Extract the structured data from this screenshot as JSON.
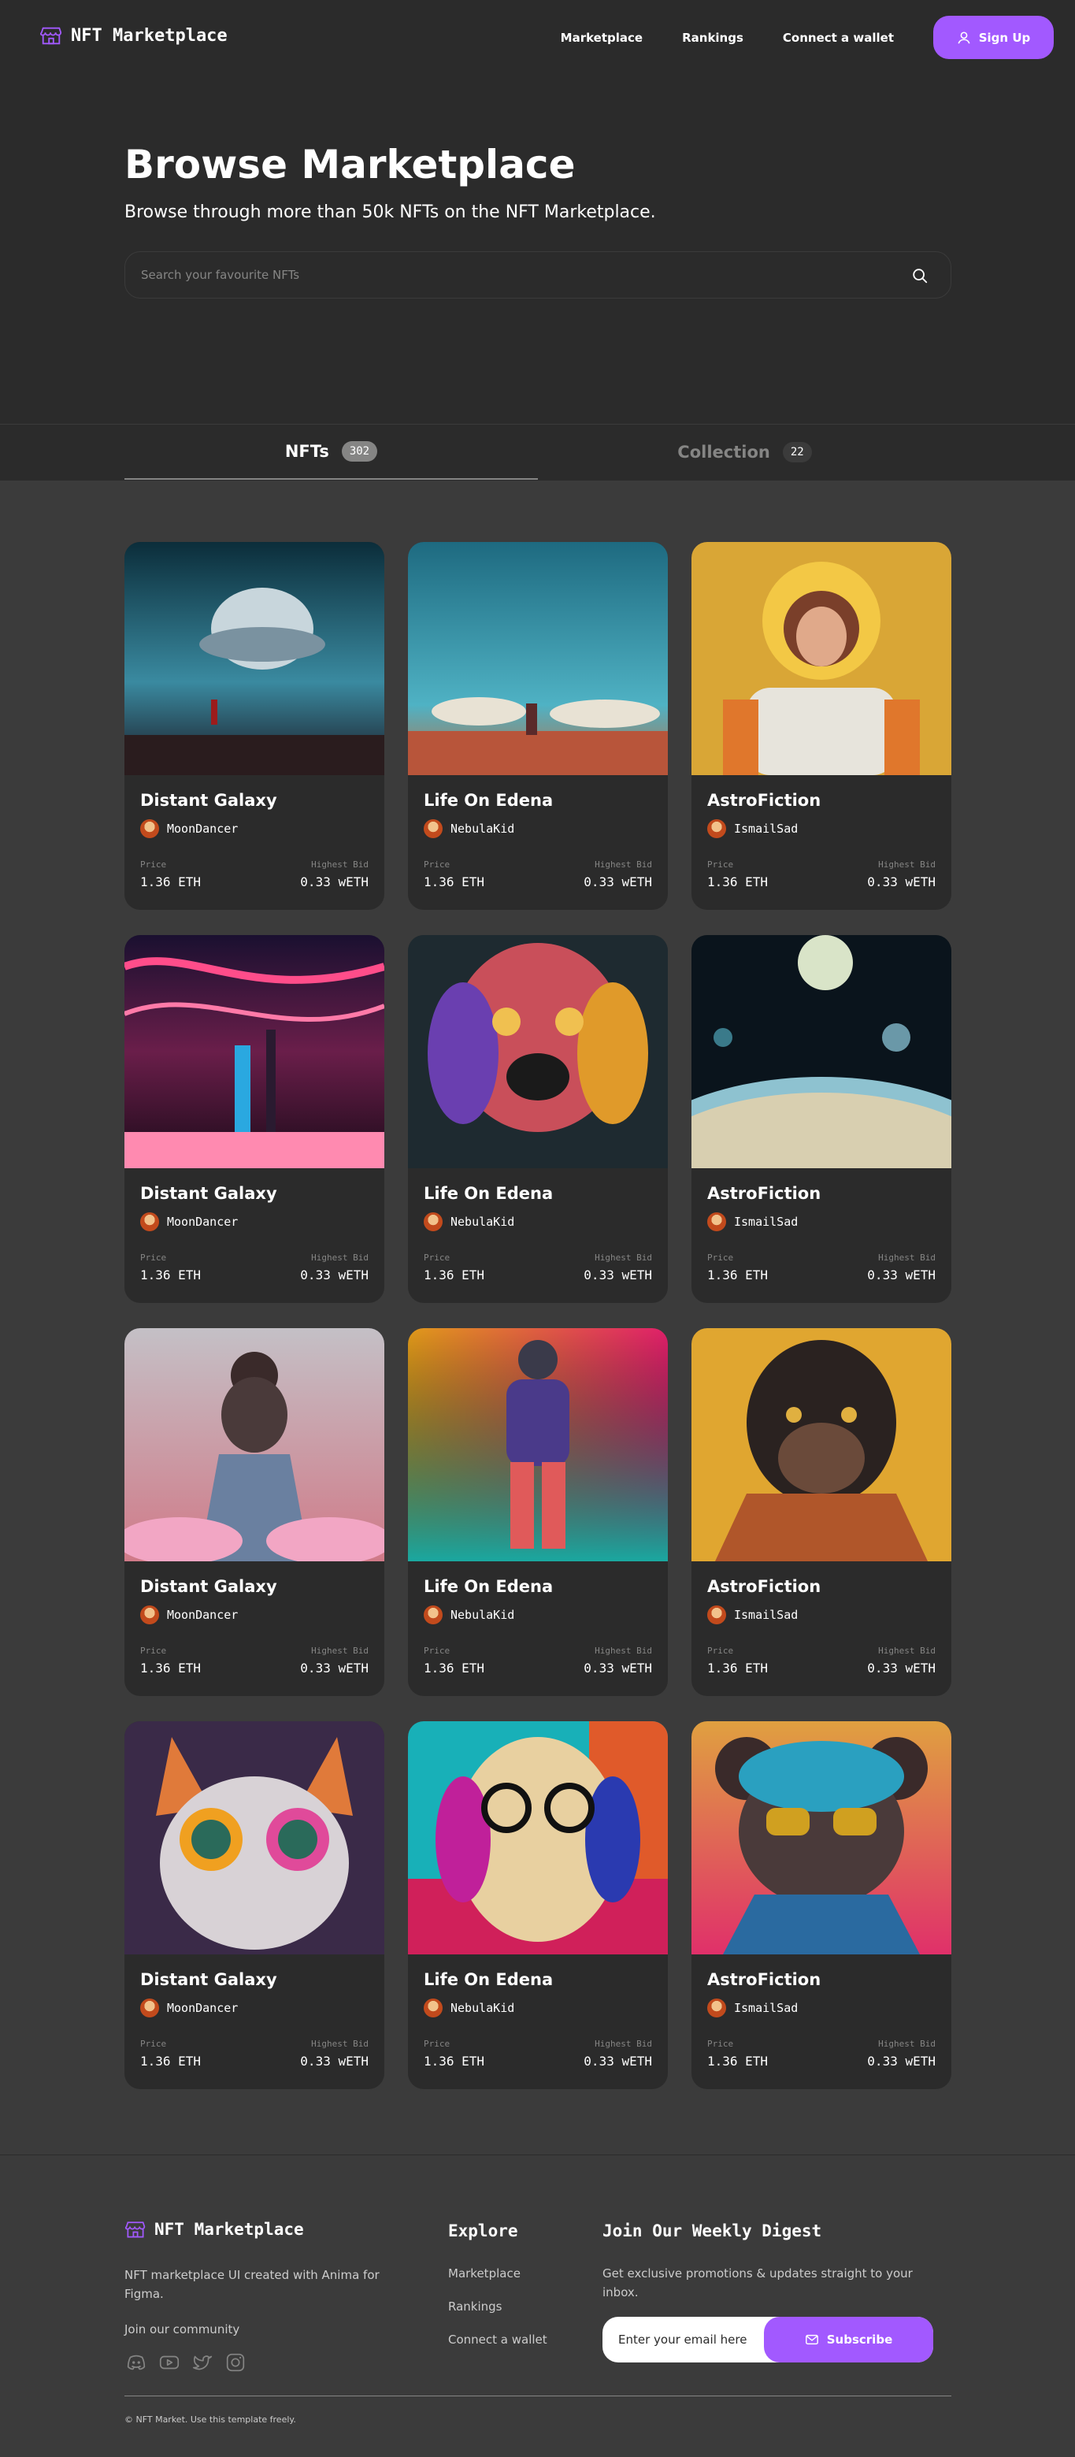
{
  "brand": {
    "name": "NFT Marketplace",
    "accent": "#a259ff",
    "bg_dark": "#2b2b2b",
    "bg_mid": "#3b3b3b",
    "muted": "#858584"
  },
  "nav": {
    "links": [
      "Marketplace",
      "Rankings",
      "Connect a wallet"
    ],
    "signup_label": "Sign Up",
    "signup_icon": "user-icon"
  },
  "hero": {
    "title": "Browse Marketplace",
    "subtitle": "Browse through more than 50k NFTs on the NFT Marketplace.",
    "search_placeholder": "Search your favourite NFTs",
    "search_icon": "search-icon"
  },
  "tabs": [
    {
      "label": "NFTs",
      "count": "302",
      "active": true
    },
    {
      "label": "Collection",
      "count": "22",
      "active": false
    }
  ],
  "cards": [
    {
      "title": "Distant Galaxy",
      "artist": "MoonDancer",
      "price_label": "Price",
      "price": "1.36 ETH",
      "bid_label": "Highest Bid",
      "bid": "0.33 wETH"
    },
    {
      "title": "Life On Edena",
      "artist": "NebulaKid",
      "price_label": "Price",
      "price": "1.36 ETH",
      "bid_label": "Highest Bid",
      "bid": "0.33 wETH"
    },
    {
      "title": "AstroFiction",
      "artist": "IsmailSad",
      "price_label": "Price",
      "price": "1.36 ETH",
      "bid_label": "Highest Bid",
      "bid": "0.33 wETH"
    },
    {
      "title": "Distant Galaxy",
      "artist": "MoonDancer",
      "price_label": "Price",
      "price": "1.36 ETH",
      "bid_label": "Highest Bid",
      "bid": "0.33 wETH"
    },
    {
      "title": "Life On Edena",
      "artist": "NebulaKid",
      "price_label": "Price",
      "price": "1.36 ETH",
      "bid_label": "Highest Bid",
      "bid": "0.33 wETH"
    },
    {
      "title": "AstroFiction",
      "artist": "IsmailSad",
      "price_label": "Price",
      "price": "1.36 ETH",
      "bid_label": "Highest Bid",
      "bid": "0.33 wETH"
    },
    {
      "title": "Distant Galaxy",
      "artist": "MoonDancer",
      "price_label": "Price",
      "price": "1.36 ETH",
      "bid_label": "Highest Bid",
      "bid": "0.33 wETH"
    },
    {
      "title": "Life On Edena",
      "artist": "NebulaKid",
      "price_label": "Price",
      "price": "1.36 ETH",
      "bid_label": "Highest Bid",
      "bid": "0.33 wETH"
    },
    {
      "title": "AstroFiction",
      "artist": "IsmailSad",
      "price_label": "Price",
      "price": "1.36 ETH",
      "bid_label": "Highest Bid",
      "bid": "0.33 wETH"
    },
    {
      "title": "Distant Galaxy",
      "artist": "MoonDancer",
      "price_label": "Price",
      "price": "1.36 ETH",
      "bid_label": "Highest Bid",
      "bid": "0.33 wETH"
    },
    {
      "title": "Life On Edena",
      "artist": "NebulaKid",
      "price_label": "Price",
      "price": "1.36 ETH",
      "bid_label": "Highest Bid",
      "bid": "0.33 wETH"
    },
    {
      "title": "AstroFiction",
      "artist": "IsmailSad",
      "price_label": "Price",
      "price": "1.36 ETH",
      "bid_label": "Highest Bid",
      "bid": "0.33 wETH"
    }
  ],
  "footer": {
    "brand": "NFT Marketplace",
    "description": "NFT marketplace UI created with Anima for Figma.",
    "join_label": "Join our community",
    "socials": [
      "discord-icon",
      "youtube-icon",
      "twitter-icon",
      "instagram-icon"
    ],
    "explore_heading": "Explore",
    "explore_links": [
      "Marketplace",
      "Rankings",
      "Connect a wallet"
    ],
    "subscribe_heading": "Join Our Weekly Digest",
    "subscribe_text": "Get exclusive promotions & updates straight to your inbox.",
    "email_placeholder": "Enter your email here",
    "subscribe_label": "Subscribe",
    "copyright": "© NFT Market. Use this template freely."
  }
}
